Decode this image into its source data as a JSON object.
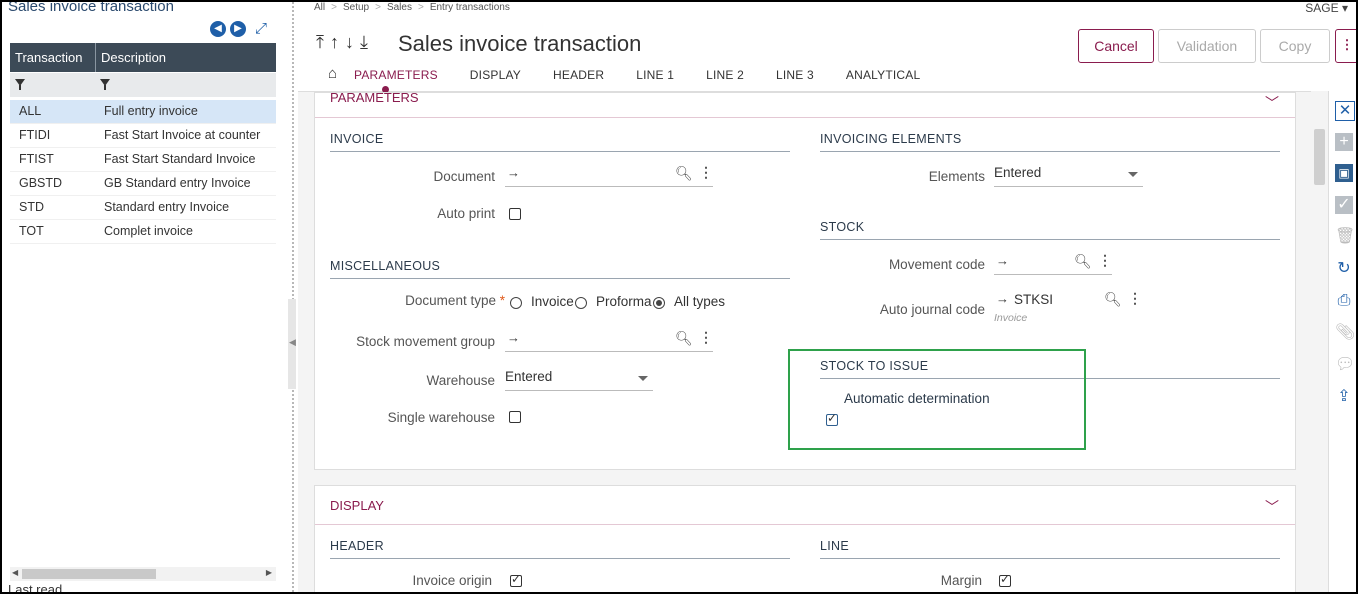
{
  "left_panel": {
    "title": "Sales invoice transaction",
    "columns": [
      "Transaction",
      "Description"
    ],
    "rows": [
      {
        "code": "ALL",
        "desc": "Full entry invoice"
      },
      {
        "code": "FTIDI",
        "desc": "Fast Start Invoice at counter"
      },
      {
        "code": "FTIST",
        "desc": "Fast Start Standard Invoice"
      },
      {
        "code": "GBSTD",
        "desc": "GB Standard entry Invoice"
      },
      {
        "code": "STD",
        "desc": "Standard entry Invoice"
      },
      {
        "code": "TOT",
        "desc": "Complet invoice"
      }
    ],
    "last_read": "Last read"
  },
  "breadcrumb": [
    "All",
    "Setup",
    "Sales",
    "Entry transactions"
  ],
  "user_menu": "SAGE",
  "page_title": "Sales invoice transaction",
  "buttons": {
    "cancel": "Cancel",
    "validation": "Validation",
    "copy": "Copy"
  },
  "tabs": [
    "PARAMETERS",
    "DISPLAY",
    "HEADER",
    "LINE 1",
    "LINE 2",
    "LINE 3",
    "ANALYTICAL"
  ],
  "parameters": {
    "title": "PARAMETERS",
    "invoice": {
      "title": "INVOICE",
      "document_label": "Document",
      "document_value": "",
      "auto_print_label": "Auto print",
      "auto_print": false
    },
    "misc": {
      "title": "MISCELLANEOUS",
      "doc_type_label": "Document type",
      "doc_type_options": [
        "Invoice",
        "Proforma",
        "All types"
      ],
      "doc_type_selected": "All types",
      "stock_group_label": "Stock movement group",
      "warehouse_label": "Warehouse",
      "warehouse_value": "Entered",
      "single_wh_label": "Single warehouse",
      "single_wh": false
    },
    "invoicing": {
      "title": "INVOICING ELEMENTS",
      "elements_label": "Elements",
      "elements_value": "Entered"
    },
    "stock": {
      "title": "STOCK",
      "movement_label": "Movement code",
      "movement_value": "",
      "journal_label": "Auto journal code",
      "journal_value": "STKSI",
      "journal_hint": "Invoice"
    },
    "stock_issue": {
      "title": "STOCK TO ISSUE",
      "auto_label": "Automatic determination",
      "auto": true
    }
  },
  "display": {
    "title": "DISPLAY",
    "header_title": "HEADER",
    "line_title": "LINE",
    "invoice_origin_label": "Invoice origin",
    "invoice_origin": true,
    "margin_label": "Margin",
    "margin": true
  },
  "colors": {
    "accent": "#8a1c4e",
    "highlight": "#2ea14b",
    "header_bg": "#3c4a57"
  }
}
